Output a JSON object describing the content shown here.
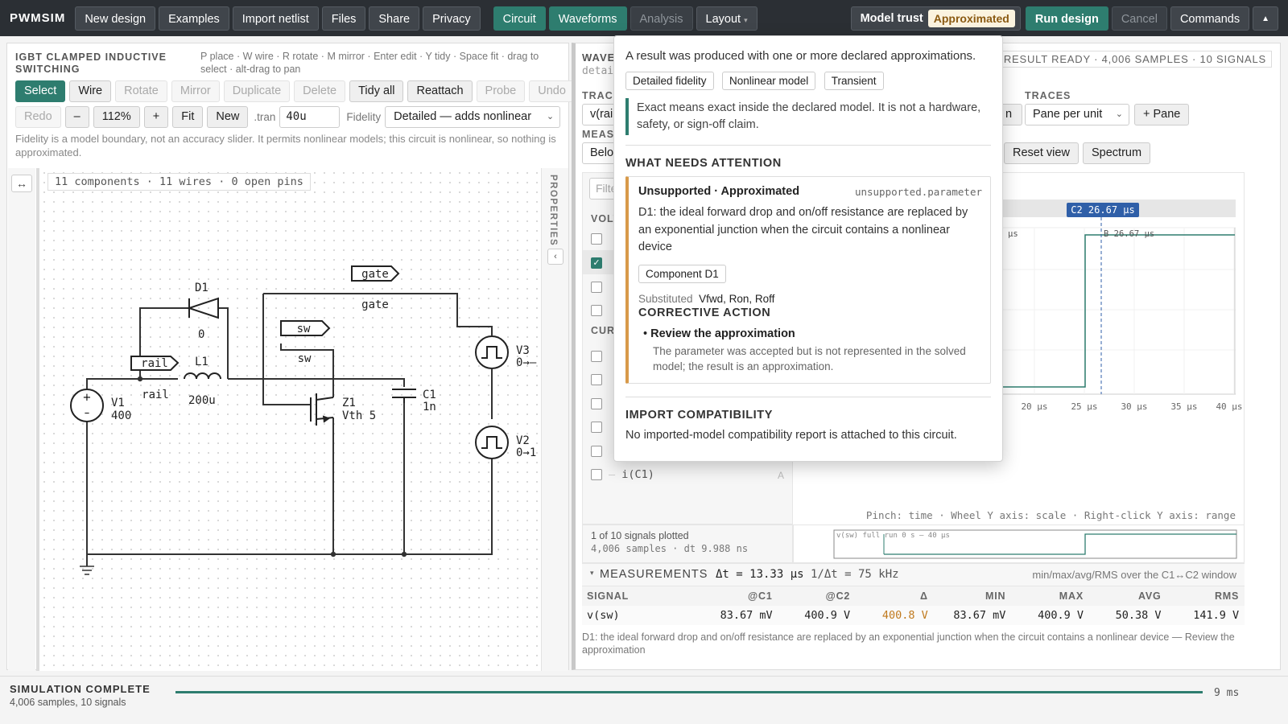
{
  "app": {
    "name": "PWMSIM"
  },
  "topbar": {
    "new_design": "New design",
    "examples": "Examples",
    "import_netlist": "Import netlist",
    "files": "Files",
    "share": "Share",
    "privacy": "Privacy",
    "circuit": "Circuit",
    "waveforms": "Waveforms",
    "analysis": "Analysis",
    "layout": "Layout",
    "model_trust_label": "Model trust",
    "model_trust_value": "Approximated",
    "run_design": "Run design",
    "cancel": "Cancel",
    "commands": "Commands"
  },
  "circuit_panel": {
    "title": "IGBT CLAMPED INDUCTIVE SWITCHING",
    "hint": "P place · W wire · R rotate · M mirror · Enter edit · Y tidy · Space fit · drag to select · alt-drag to pan",
    "tools": [
      "Select",
      "Wire",
      "Rotate",
      "Mirror",
      "Duplicate",
      "Delete",
      "Tidy all",
      "Reattach",
      "Probe",
      "Undo"
    ],
    "redo": "Redo",
    "zoom_out": "–",
    "zoom": "112%",
    "zoom_in": "+",
    "fit": "Fit",
    "new": "New",
    "tran_label": ".tran",
    "tran_value": "40u",
    "fidelity_label": "Fidelity",
    "fidelity_value": "Detailed — adds nonlinear",
    "fidelity_note": "Fidelity is a model boundary, not an accuracy slider. It permits nonlinear models; this circuit is nonlinear, so nothing is approximated.",
    "stats": "11 components · 11 wires · 0 open pins",
    "properties_label": "PROPERTIES"
  },
  "schematic": {
    "gate_tag": "gate",
    "gate_label": "gate",
    "sw_tag": "sw",
    "sw_label": "sw",
    "rail_tag": "rail",
    "rail_label": "rail",
    "D1": {
      "name": "D1",
      "value": "0"
    },
    "L1": {
      "name": "L1",
      "value": "200u"
    },
    "V1": {
      "name": "V1",
      "value": "400"
    },
    "Z1": {
      "name": "Z1",
      "value": "Vth 5"
    },
    "C1": {
      "name": "C1",
      "value": "1n"
    },
    "V3": {
      "name": "V3",
      "value": "0→–"
    },
    "V2": {
      "name": "V2",
      "value": "0→1"
    }
  },
  "wave_panel": {
    "title": "WAVE",
    "subtitle": "detai",
    "result": "RESULT READY · 4,006 SAMPLES · 10 SIGNALS",
    "trace_label": "TRACE",
    "trace_value": "v(rai",
    "meas_label": "MEASU",
    "meas_value": "Belo",
    "traces_label": "TRACES",
    "traces_value": "Pane per unit",
    "add_pane": "+ Pane",
    "partial_btn": "n",
    "reset_view": "Reset view",
    "spectrum": "Spectrum",
    "filter_placeholder": "Filte",
    "group_voltage": "VOLT",
    "group_current": "CUR",
    "last_signal": "i(C1)",
    "last_signal_unit": "A",
    "cursor_c2": "C2 26.67 µs",
    "cursor_b": "B 26.67 µs",
    "tick_partial": "µs",
    "x_ticks": [
      "20 µs",
      "25 µs",
      "30 µs",
      "35 µs",
      "40 µs"
    ],
    "pinch_hint": "Pinch: time · Wheel Y axis: scale · Right-click Y axis: range",
    "plotted": "1 of 10 signals plotted",
    "samples": "4,006 samples · dt 9.988 ns",
    "overview_label": "v(sw)  full run 0 s — 40 µs"
  },
  "measurements": {
    "title": "MEASUREMENTS",
    "dt": "Δt = 13.33 µs",
    "inv_dt": "1/Δt = 75 kHz",
    "window_note": "min/max/avg/RMS over the C1↔C2 window",
    "headers": [
      "SIGNAL",
      "@C1",
      "@C2",
      "Δ",
      "MIN",
      "MAX",
      "AVG",
      "RMS"
    ],
    "row": [
      "v(sw)",
      "83.67 mV",
      "400.9 V",
      "400.8 V",
      "83.67 mV",
      "400.9 V",
      "50.38 V",
      "141.9 V"
    ],
    "warning": "D1: the ideal forward drop and on/off resistance are replaced by an exponential junction when the circuit contains a nonlinear device — Review the approximation"
  },
  "popup": {
    "intro": "A result was produced with one or more declared approximations.",
    "tags": [
      "Detailed fidelity",
      "Nonlinear model",
      "Transient"
    ],
    "note": "Exact means exact inside the declared model. It is not a hardware, safety, or sign-off claim.",
    "attention_title": "WHAT NEEDS ATTENTION",
    "issue_title": "Unsupported · Approximated",
    "issue_code": "unsupported.parameter",
    "issue_text": "D1: the ideal forward drop and on/off resistance are replaced by an exponential junction when the circuit contains a nonlinear device",
    "component_tag": "Component D1",
    "substituted_label": "Substituted",
    "substituted_value": "Vfwd, Ron, Roff",
    "corrective_title": "CORRECTIVE ACTION",
    "action_title": "Review the approximation",
    "action_text": "The parameter was accepted but is not represented in the solved model; the result is an approximation.",
    "import_title": "IMPORT COMPATIBILITY",
    "import_text": "No imported-model compatibility report is attached to this circuit."
  },
  "status": {
    "title": "SIMULATION COMPLETE",
    "detail": "4,006 samples, 10 signals",
    "time": "9 ms"
  },
  "colors": {
    "accent": "#2e7d6f",
    "warning": "#d89a4a",
    "cursor": "#2f5fa8"
  }
}
